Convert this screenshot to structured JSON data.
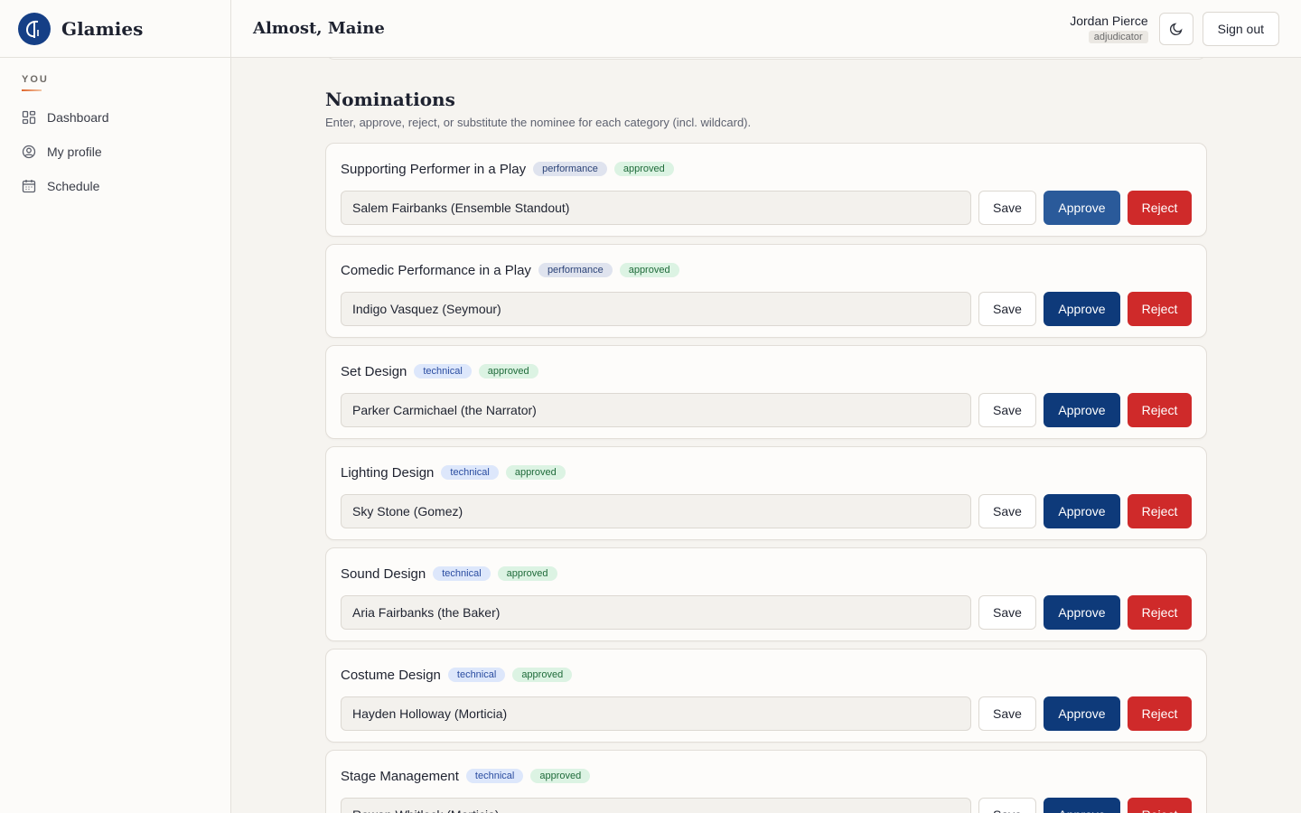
{
  "brand": {
    "name": "Glamies"
  },
  "sidebar": {
    "section_heading": "YOU",
    "items": [
      {
        "label": "Dashboard",
        "icon": "dashboard-icon"
      },
      {
        "label": "My profile",
        "icon": "user-circle-icon"
      },
      {
        "label": "Schedule",
        "icon": "calendar-icon"
      }
    ]
  },
  "header": {
    "title": "Almost, Maine",
    "user_name": "Jordan Pierce",
    "user_role": "adjudicator",
    "theme_toggle_icon": "moon-icon",
    "signout_label": "Sign out"
  },
  "nominations": {
    "title": "Nominations",
    "description": "Enter, approve, reject, or substitute the nominee for each category (incl. wildcard).",
    "save_label": "Save",
    "approve_label": "Approve",
    "reject_label": "Reject",
    "categories": [
      {
        "title": "Supporting Performer in a Play",
        "type": "performance",
        "status": "approved",
        "nominee": "Salem Fairbanks (Ensemble Standout)"
      },
      {
        "title": "Comedic Performance in a Play",
        "type": "performance",
        "status": "approved",
        "nominee": "Indigo Vasquez (Seymour)"
      },
      {
        "title": "Set Design",
        "type": "technical",
        "status": "approved",
        "nominee": "Parker Carmichael (the Narrator)"
      },
      {
        "title": "Lighting Design",
        "type": "technical",
        "status": "approved",
        "nominee": "Sky Stone (Gomez)"
      },
      {
        "title": "Sound Design",
        "type": "technical",
        "status": "approved",
        "nominee": "Aria Fairbanks (the Baker)"
      },
      {
        "title": "Costume Design",
        "type": "technical",
        "status": "approved",
        "nominee": "Hayden Holloway (Morticia)"
      },
      {
        "title": "Stage Management",
        "type": "technical",
        "status": "approved",
        "nominee": "Rowan Whitlock (Morticia)"
      }
    ]
  },
  "colors": {
    "primary": "#0e3a7a",
    "danger": "#cf2a2a",
    "background": "#f6f4f0"
  }
}
